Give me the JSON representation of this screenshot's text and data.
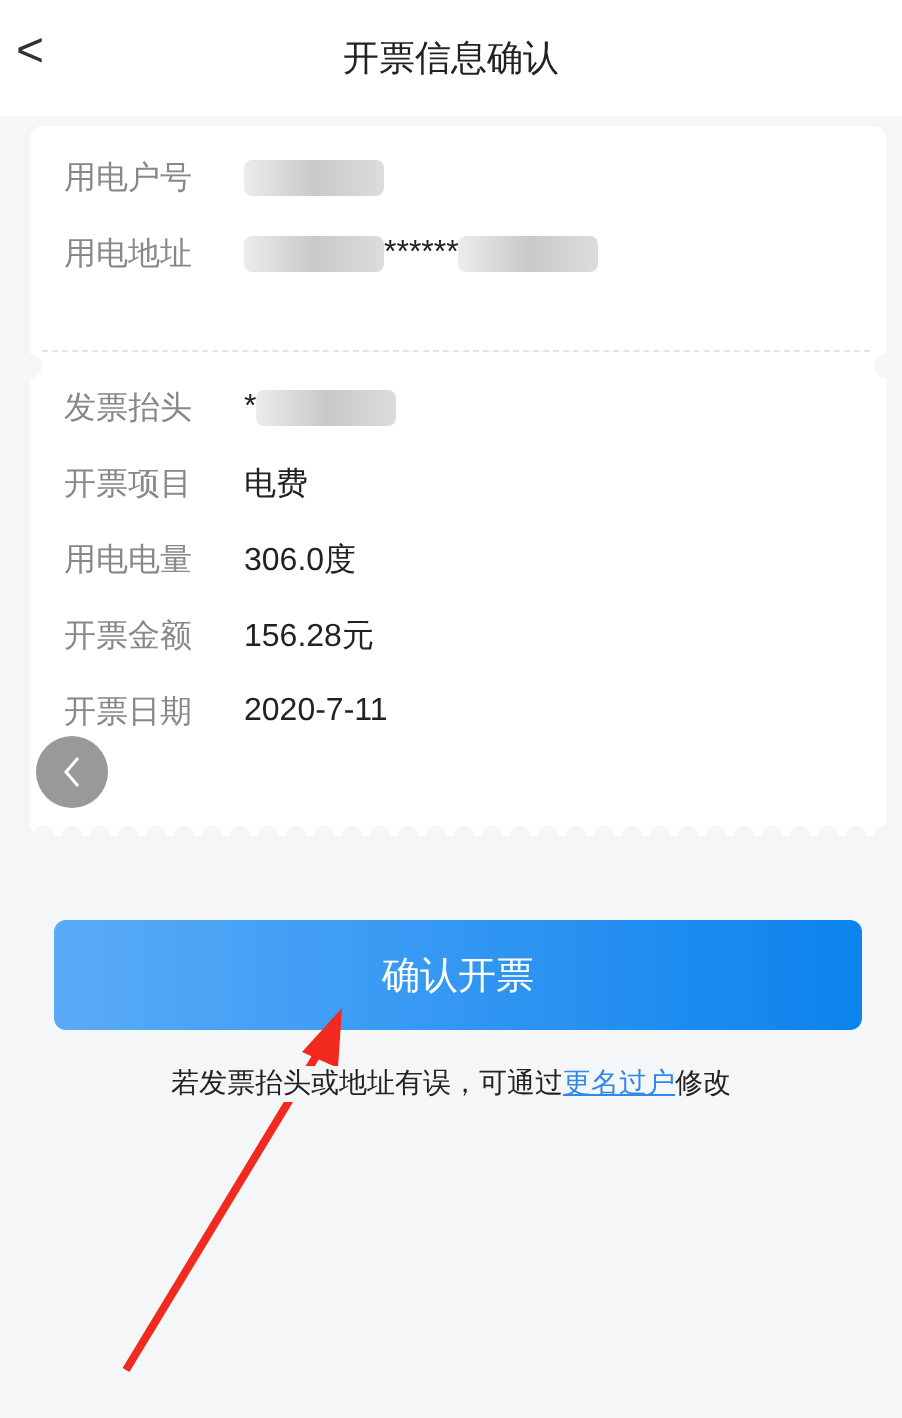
{
  "header": {
    "back": "<",
    "title": "开票信息确认"
  },
  "account_section": [
    {
      "label": "用电户号",
      "value": [
        {
          "kind": "redacted"
        }
      ]
    },
    {
      "label": "用电地址",
      "value": [
        {
          "kind": "redacted"
        },
        {
          "kind": "text",
          "text": "******"
        },
        {
          "kind": "redacted"
        }
      ]
    }
  ],
  "invoice_section": [
    {
      "label": "发票抬头",
      "value": [
        {
          "kind": "text",
          "text": "*"
        },
        {
          "kind": "redacted"
        }
      ]
    },
    {
      "label": "开票项目",
      "value": [
        {
          "kind": "text",
          "text": "电费"
        }
      ]
    },
    {
      "label": "用电电量",
      "value": [
        {
          "kind": "text",
          "text": "306.0度"
        }
      ]
    },
    {
      "label": "开票金额",
      "value": [
        {
          "kind": "text",
          "text": "156.28元"
        }
      ]
    },
    {
      "label": "开票日期",
      "value": [
        {
          "kind": "text",
          "text": "2020-7-11"
        }
      ]
    }
  ],
  "confirm_button": "确认开票",
  "note": {
    "before": "若发票抬头或地址有误，可通过",
    "link": "更名过户",
    "after": "修改"
  }
}
